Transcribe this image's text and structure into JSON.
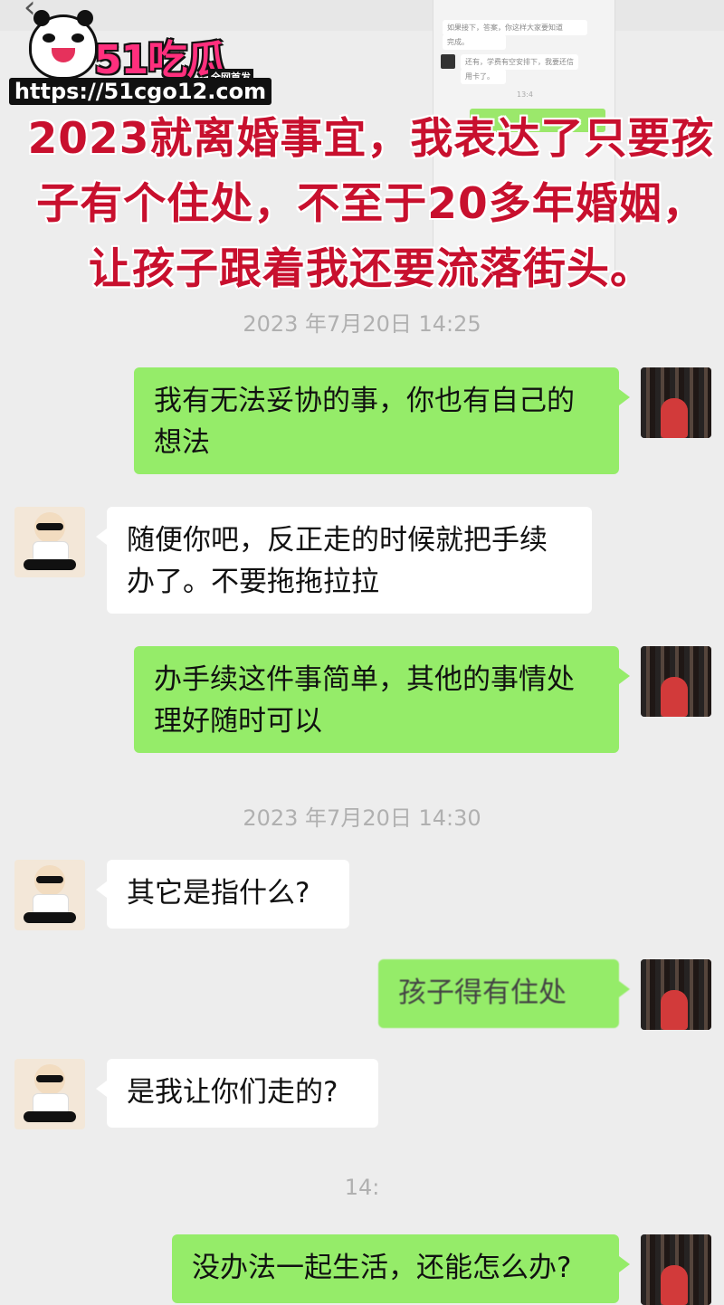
{
  "header": {
    "back_icon": "chevron-left-icon",
    "title": ""
  },
  "watermark": {
    "brand": "51吃瓜",
    "tag": "全网首发",
    "url": "https://51cgo12.com"
  },
  "headline": "2023就离婚事宜，我表达了只要孩子有个住处，不至于20多年婚姻，让孩子跟着我还要流落街头。",
  "messages": [
    {
      "type": "timestamp",
      "text": "2023 年7月20日 14:25"
    },
    {
      "type": "sent",
      "text": "我有无法妥协的事，你也有自己的想法"
    },
    {
      "type": "received",
      "text": "随便你吧，反正走的时候就把手续办了。不要拖拖拉拉"
    },
    {
      "type": "sent",
      "text": "办手续这件事简单，其他的事情处理好随时可以"
    },
    {
      "type": "timestamp",
      "text": "2023 年7月20日 14:30"
    },
    {
      "type": "received",
      "text": "其它是指什么?"
    },
    {
      "type": "sent",
      "text": "孩子得有住处"
    },
    {
      "type": "received",
      "text": "是我让你们走的?"
    },
    {
      "type": "timestamp",
      "text": "14:"
    },
    {
      "type": "sent",
      "text": "没办法一起生活，还能怎么办?"
    }
  ],
  "inset_screenshot": {
    "lines": [
      "如果接下，答案，你这样大家要知道",
      "完成。",
      "还有，学费有空安排下，我要还信",
      "用卡了。",
      "13:4"
    ]
  }
}
